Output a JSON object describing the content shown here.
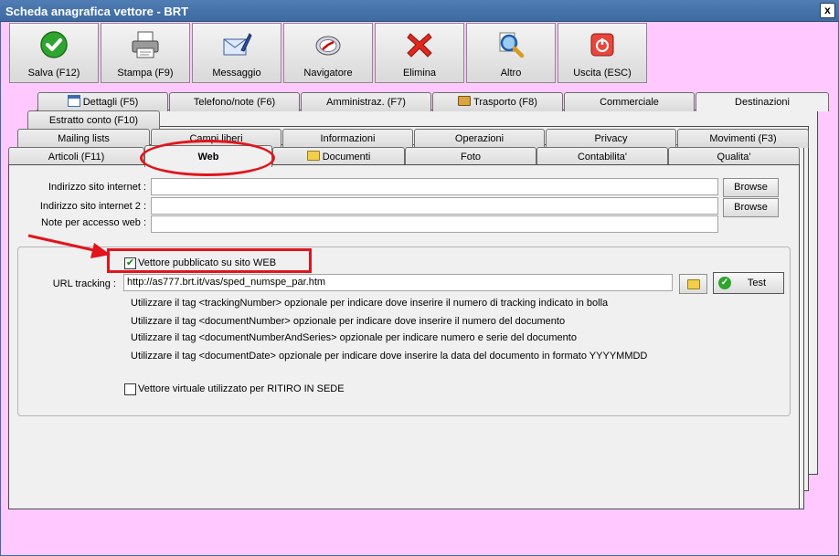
{
  "window": {
    "title": "Scheda anagrafica vettore - BRT",
    "close_glyph": "x"
  },
  "toolbar": [
    {
      "label": "Salva (F12)",
      "icon": "check-icon"
    },
    {
      "label": "Stampa (F9)",
      "icon": "printer-icon"
    },
    {
      "label": "Messaggio",
      "icon": "envelope-icon"
    },
    {
      "label": "Navigatore",
      "icon": "compass-icon"
    },
    {
      "label": "Elimina",
      "icon": "delete-x-icon"
    },
    {
      "label": "Altro",
      "icon": "magnifier-icon"
    },
    {
      "label": "Uscita (ESC)",
      "icon": "power-icon"
    }
  ],
  "tabs": {
    "row1": [
      "Dettagli (F5)",
      "Telefono/note (F6)",
      "Amministraz. (F7)",
      "Trasporto (F8)",
      "Commerciale",
      "Destinazioni"
    ],
    "row2": [
      "Estratto conto (F10)"
    ],
    "row3": [
      "Mailing lists",
      "Campi liberi",
      "Informazioni",
      "Operazioni",
      "Privacy",
      "Movimenti (F3)"
    ],
    "row4": [
      "Articoli (F11)",
      "Web",
      "Documenti",
      "Foto",
      "Contabilita'",
      "Qualita'"
    ]
  },
  "web": {
    "site_label": "Indirizzo sito internet :",
    "site_value": "",
    "site2_label": "Indirizzo sito internet 2 :",
    "site2_value": "",
    "notes_label": "Note per accesso web :",
    "notes_value": "",
    "browse_label": "Browse",
    "published_label": "Vettore pubblicato su sito WEB",
    "published_checked": true,
    "url_label": "URL tracking :",
    "url_value": "http://as777.brt.it/vas/sped_numspe_par.htm",
    "test_label": "Test",
    "info_lines": [
      "Utilizzare il tag <trackingNumber> opzionale per indicare dove inserire il numero di tracking indicato in bolla",
      "Utilizzare il tag <documentNumber> opzionale per indicare dove inserire il numero del documento",
      "Utilizzare il tag <documentNumberAndSeries> opzionale per indicare numero e serie del documento",
      "Utilizzare il tag <documentDate> opzionale per indicare dove inserire la data del documento in formato YYYYMMDD"
    ],
    "virtual_label": "Vettore virtuale utilizzato per RITIRO IN SEDE",
    "virtual_checked": false
  },
  "colors": {
    "title_bar": "#4f7db4",
    "background": "#ffc8ff",
    "annotation_red": "#e2141c"
  }
}
